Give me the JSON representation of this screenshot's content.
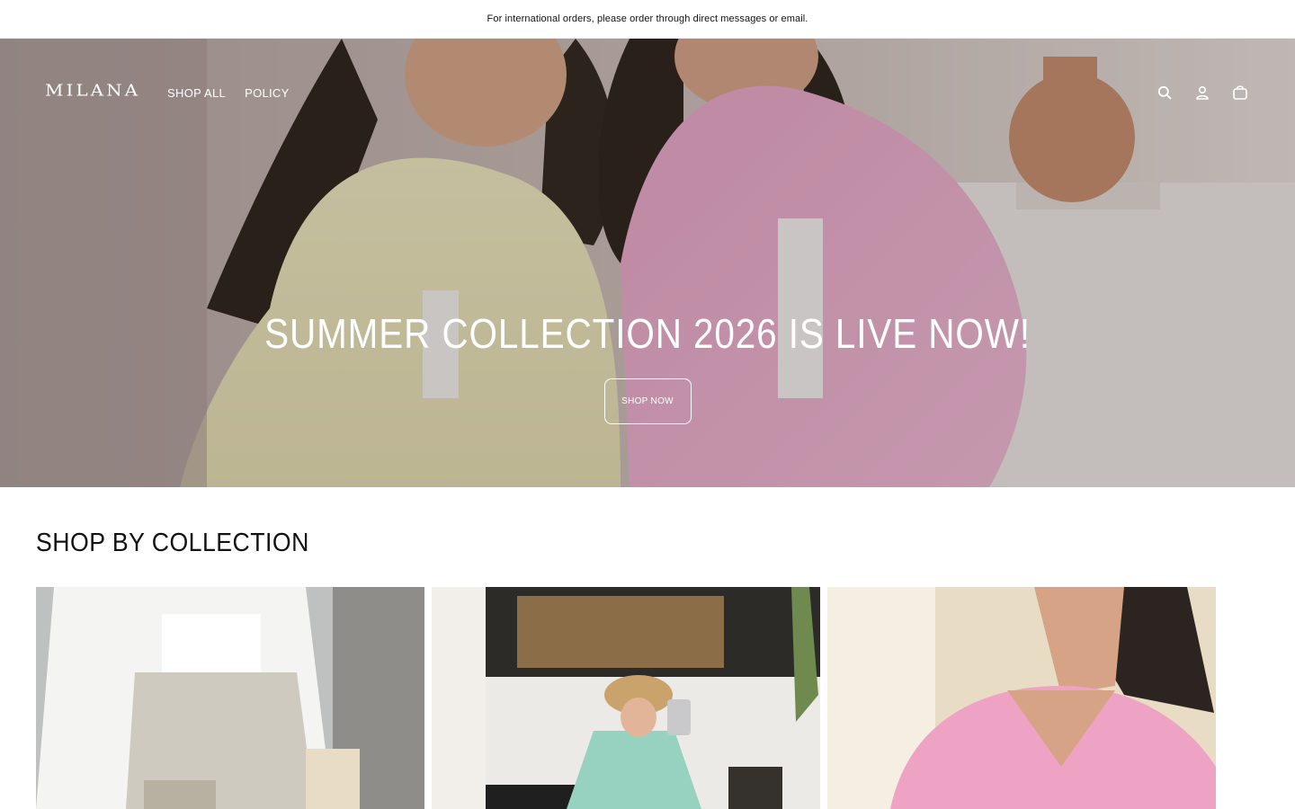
{
  "announcement": {
    "text": "For international orders, please order through direct messages or email."
  },
  "header": {
    "logo_text": "MILANA",
    "nav": [
      {
        "label": "SHOP ALL"
      },
      {
        "label": "POLICY"
      }
    ],
    "icons": [
      "search-icon",
      "account-icon",
      "cart-icon"
    ]
  },
  "hero": {
    "title": "SUMMER COLLECTION 2026 IS LIVE NOW!",
    "button_label": "SHOP NOW"
  },
  "collections": {
    "title": "SHOP BY COLLECTION",
    "cards": [
      {
        "image": "white-linen-outfit-photo"
      },
      {
        "image": "mint-kaftan-mirror-selfie-photo"
      },
      {
        "image": "pink-linen-top-photo"
      }
    ]
  },
  "colors": {
    "text": "#121212",
    "background": "#ffffff",
    "hero_text": "#ffffff"
  }
}
